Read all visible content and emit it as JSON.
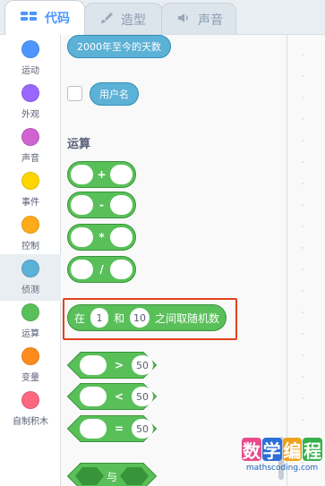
{
  "tabs": [
    {
      "label": "代码",
      "icon": "code-icon",
      "active": true
    },
    {
      "label": "造型",
      "icon": "brush-icon",
      "active": false
    },
    {
      "label": "声音",
      "icon": "speaker-icon",
      "active": false
    }
  ],
  "categories": [
    {
      "label": "运动",
      "color": "#4c97ff"
    },
    {
      "label": "外观",
      "color": "#9966ff"
    },
    {
      "label": "声音",
      "color": "#cf63cf"
    },
    {
      "label": "事件",
      "color": "#ffd500"
    },
    {
      "label": "控制",
      "color": "#ffab19"
    },
    {
      "label": "侦测",
      "color": "#5cb1d6"
    },
    {
      "label": "运算",
      "color": "#59c059"
    },
    {
      "label": "变量",
      "color": "#ff8c1a"
    },
    {
      "label": "自制积木",
      "color": "#ff6680"
    }
  ],
  "selected_category": "侦测",
  "sensing": {
    "days_since_2000": "2000年至今的天数",
    "username": "用户名"
  },
  "operators": {
    "section_title": "运算",
    "arith_signs": [
      "+",
      "-",
      "*",
      "/"
    ],
    "random": {
      "prefix": "在",
      "from": "1",
      "middle": "和",
      "to": "10",
      "suffix": "之间取随机数"
    },
    "compare": [
      {
        "sign": ">",
        "value": "50"
      },
      {
        "sign": "<",
        "value": "50"
      },
      {
        "sign": "=",
        "value": "50"
      }
    ],
    "and_label": "与"
  },
  "watermark": {
    "chars": [
      "数",
      "学",
      "编",
      "程"
    ],
    "char_colors": [
      "#e84a8a",
      "#2d6fd6",
      "#f0a21a",
      "#36b04a"
    ],
    "url": "mathscoding.com"
  },
  "colors": {
    "operators_green": "#59c059",
    "sensing_blue": "#5cb1d6",
    "highlight_red": "#e2421d",
    "tab_active": "#4c97ff"
  }
}
